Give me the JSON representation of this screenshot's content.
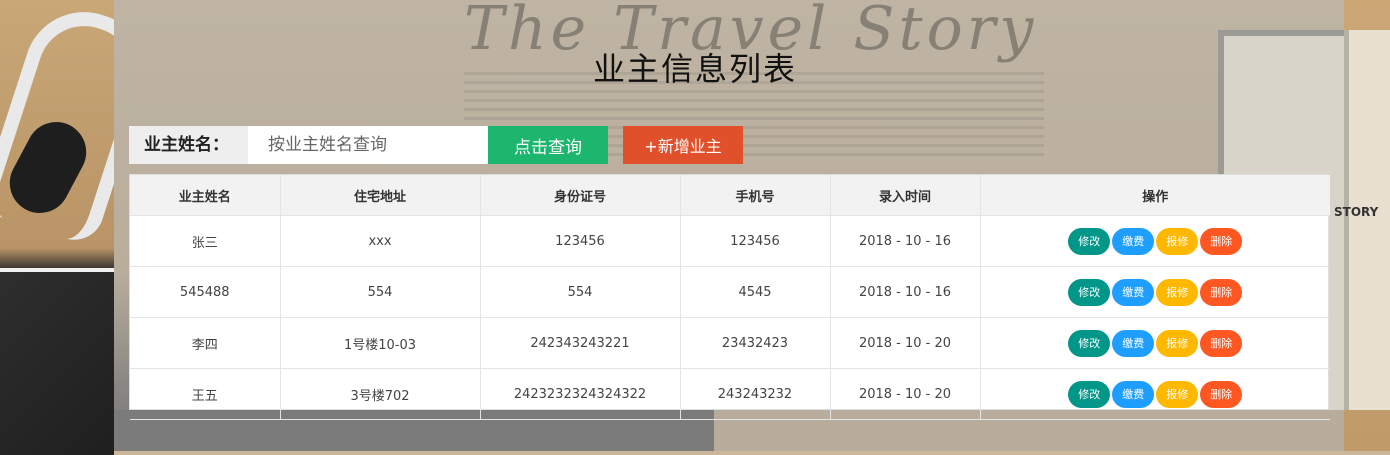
{
  "background": {
    "watermark_text": "The Travel Story",
    "side_text": "STORY"
  },
  "page": {
    "title": "业主信息列表"
  },
  "search": {
    "label": "业主姓名：",
    "placeholder": "按业主姓名查询",
    "value": "",
    "query_button": "点击查询",
    "add_button": "+新增业主"
  },
  "table": {
    "columns": [
      "业主姓名",
      "住宅地址",
      "身份证号",
      "手机号",
      "录入时间",
      "操作"
    ],
    "rows": [
      {
        "name": "张三",
        "address": "xxx",
        "id_number": "123456",
        "phone": "123456",
        "date": "2018 - 10 - 16"
      },
      {
        "name": "545488",
        "address": "554",
        "id_number": "554",
        "phone": "4545",
        "date": "2018 - 10 - 16"
      },
      {
        "name": "李四",
        "address": "1号楼10-03",
        "id_number": "242343243221",
        "phone": "23432423",
        "date": "2018 - 10 - 20"
      },
      {
        "name": "王五",
        "address": "3号楼702",
        "id_number": "2423232324324322",
        "phone": "243243232",
        "date": "2018 - 10 - 20"
      }
    ],
    "actions": {
      "edit": "修改",
      "pay": "缴费",
      "repair": "报修",
      "delete": "删除"
    }
  },
  "colors": {
    "query_button": "#1db66e",
    "add_button": "#e0502b",
    "edit": "#009688",
    "pay": "#1e9fff",
    "repair": "#ffb800",
    "delete": "#ff5722"
  }
}
